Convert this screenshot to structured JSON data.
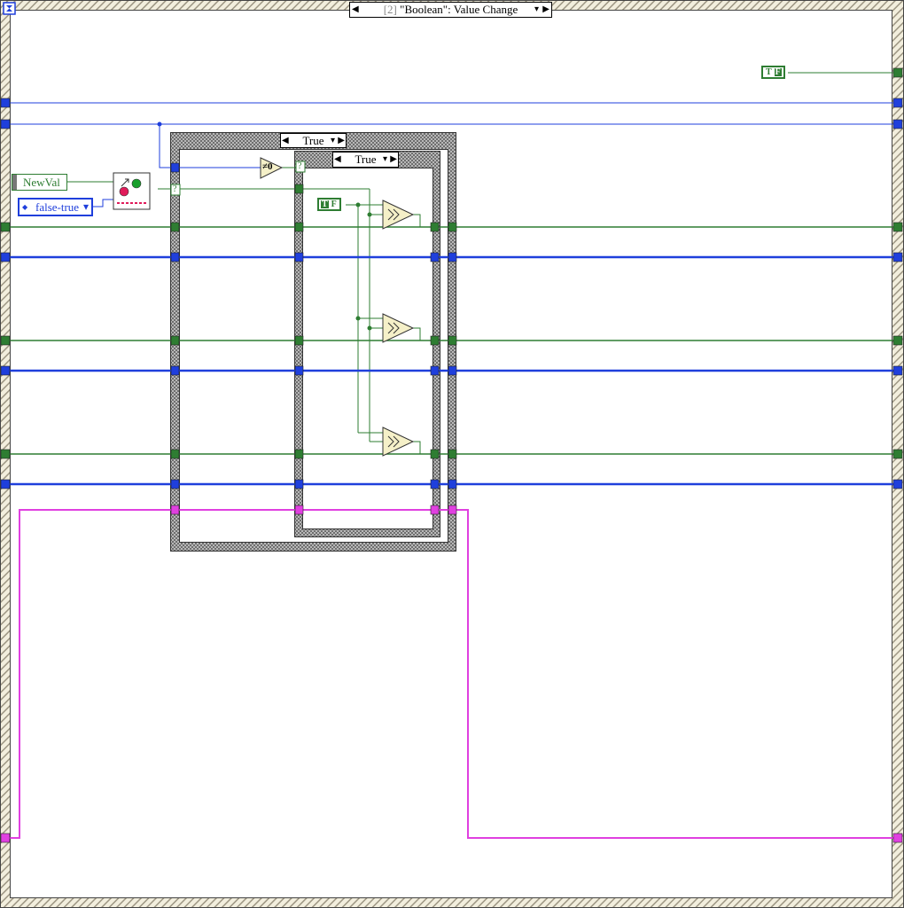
{
  "event_structure": {
    "selector_index": "[2]",
    "selector_label": "\"Boolean\": Value Change",
    "left_arrow": "◀",
    "right_arrow": "▶"
  },
  "outer_case": {
    "selector_label": "True",
    "left_arrow": "◀",
    "right_arrow": "▶",
    "neq_zero_label": "≠0",
    "selector_terminal": "?"
  },
  "inner_case": {
    "selector_label": "True",
    "left_arrow": "◀",
    "right_arrow": "▶",
    "selector_terminal": "?"
  },
  "event_data": {
    "newval_label": "NewVal"
  },
  "enum_constant": {
    "label": "false-true",
    "increment_icon": "◆",
    "dropdown_icon": "▾"
  },
  "constants": {
    "tf_true": "T",
    "tf_false_label": "F",
    "tf_top": "T",
    "tf_top_false": "F"
  },
  "icons": {
    "timeout_icon": "hourglass-icon",
    "transition_vi": "boolean-transition-icon",
    "select_functions": [
      "select-icon",
      "select-icon",
      "select-icon"
    ]
  },
  "colors": {
    "boolean_wire": "#2e7d32",
    "numeric_wire": "#1f3fdc",
    "cluster_wire": "#e040e0",
    "frame": "#8a8a8a",
    "select_fill": "#f5f0c8"
  }
}
